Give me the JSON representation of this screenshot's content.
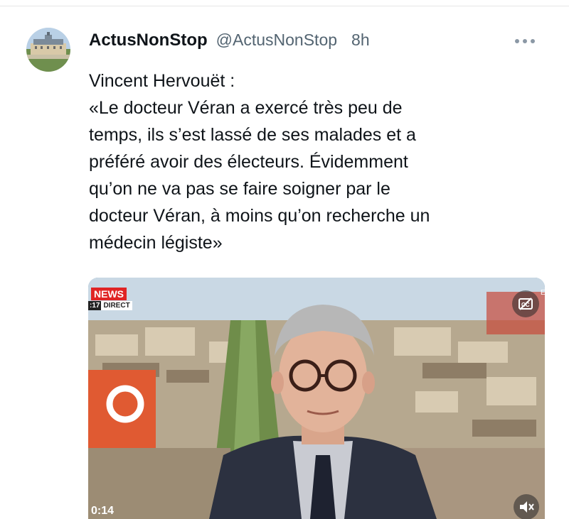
{
  "tweet": {
    "display_name": "ActusNonStop",
    "handle": "@ActusNonStop",
    "time": "8h",
    "text_lines": [
      "Vincent Hervouët :",
      "«Le docteur Véran a exercé très peu de",
      "temps, ils s’est lassé de ses malades et a",
      "préféré avoir des électeurs. Évidemment",
      "qu’on ne va pas se faire soigner par le",
      "docteur Véran, à moins qu’on recherche un",
      "médecin légiste»"
    ]
  },
  "video": {
    "news_badge": "NEWS",
    "clock_text": ":17",
    "live_text": "DIRECT",
    "duration": "0:14",
    "edge_char": "E"
  },
  "icons": {
    "more": "more-horizontal-icon",
    "captions": "closed-captions-icon",
    "mute": "speaker-muted-icon"
  },
  "colors": {
    "text_primary": "#0f1419",
    "text_secondary": "#536471",
    "news_red": "#e02424"
  }
}
